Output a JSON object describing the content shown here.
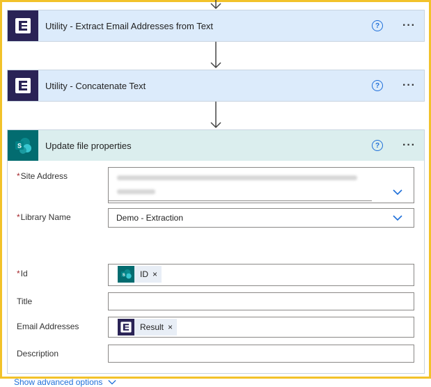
{
  "steps": [
    {
      "title": "Utility - Extract Email Addresses from Text",
      "icon": "encodian-utility-icon"
    },
    {
      "title": "Utility - Concatenate Text",
      "icon": "encodian-utility-icon"
    },
    {
      "title": "Update file properties",
      "icon": "sharepoint-icon"
    }
  ],
  "header": {
    "help_symbol": "?",
    "more_symbol": "···"
  },
  "form": {
    "required_mark": "*",
    "site_address": {
      "label": "Site Address"
    },
    "library_name": {
      "label": "Library Name",
      "value": "Demo - Extraction"
    },
    "id": {
      "label": "Id",
      "token": "ID"
    },
    "title": {
      "label": "Title"
    },
    "email_addresses": {
      "label": "Email Addresses",
      "token": "Result"
    },
    "description": {
      "label": "Description"
    },
    "token_remove_symbol": "×",
    "show_advanced": "Show advanced options"
  },
  "colors": {
    "frame": "#f2c22a",
    "utility_header": "#dcebfb",
    "sharepoint_header": "#dbeeee",
    "link": "#1e6fd9"
  }
}
